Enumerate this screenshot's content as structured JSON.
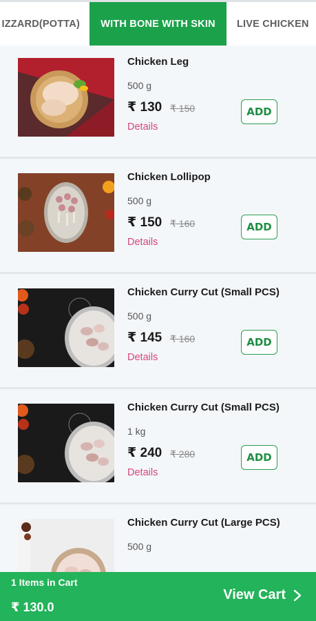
{
  "tabs": [
    {
      "label": "IZZARD(POTTA)",
      "active": false
    },
    {
      "label": "WITH BONE WITH SKIN",
      "active": true
    },
    {
      "label": "LIVE CHICKEN",
      "active": false
    }
  ],
  "colors": {
    "accent": "#1ca14b",
    "cart_bar": "#23b35a",
    "details": "#d6437e"
  },
  "products": [
    {
      "name": "Chicken Leg",
      "qty": "500 g",
      "price": "₹ 130",
      "mrp": "₹ 150",
      "details": "Details",
      "add": "ADD",
      "image": "chicken-leg-image"
    },
    {
      "name": "Chicken Lollipop",
      "qty": "500 g",
      "price": "₹ 150",
      "mrp": "₹ 160",
      "details": "Details",
      "add": "ADD",
      "image": "chicken-lollipop-image"
    },
    {
      "name": "Chicken Curry Cut (Small PCS)",
      "qty": "500 g",
      "price": "₹ 145",
      "mrp": "₹ 160",
      "details": "Details",
      "add": "ADD",
      "image": "curry-cut-image"
    },
    {
      "name": "Chicken Curry Cut (Small PCS)",
      "qty": "1 kg",
      "price": "₹ 240",
      "mrp": "₹ 280",
      "details": "Details",
      "add": "ADD",
      "image": "curry-cut-image"
    },
    {
      "name": "Chicken Curry Cut (Large PCS)",
      "qty": "500 g",
      "price": "",
      "mrp": "",
      "details": "",
      "add": "",
      "image": "curry-cut-large-image"
    }
  ],
  "cart": {
    "count_label": "1 Items in Cart",
    "total": "₹ 130.0",
    "view_label": "View Cart",
    "icon": "chevron-right-icon"
  }
}
